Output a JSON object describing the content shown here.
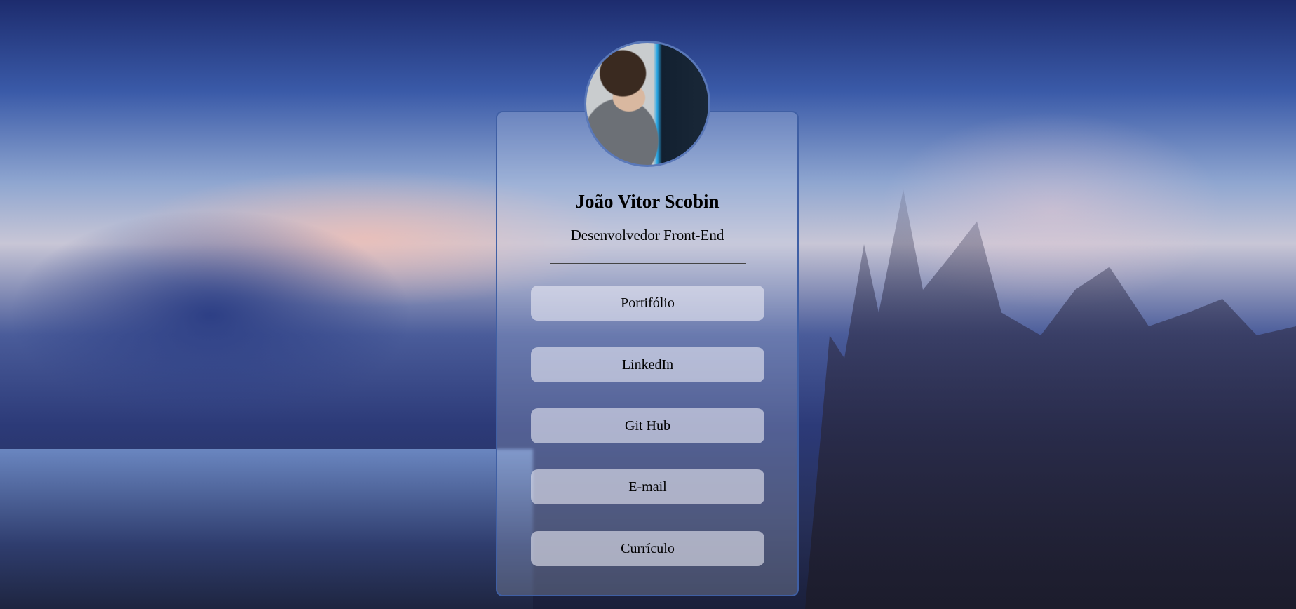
{
  "profile": {
    "name": "João Vitor Scobin",
    "role": "Desenvolvedor Front-End"
  },
  "links": [
    {
      "label": "Portifólio"
    },
    {
      "label": "LinkedIn"
    },
    {
      "label": "Git Hub"
    },
    {
      "label": "E-mail"
    },
    {
      "label": "Currículo"
    }
  ],
  "colors": {
    "card_border": "#3f5fa4",
    "avatar_border": "#5a78b8"
  }
}
